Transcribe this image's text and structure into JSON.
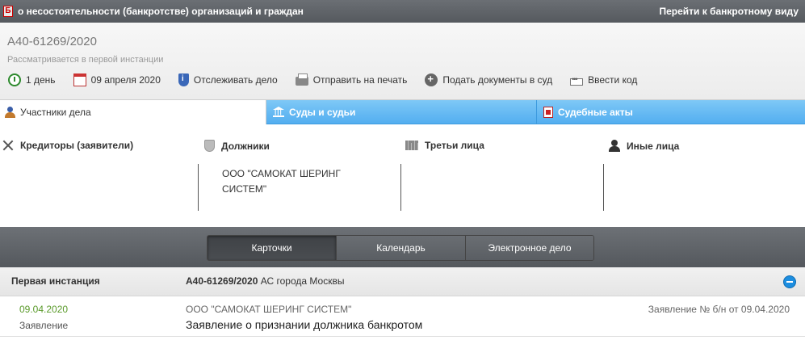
{
  "topbar": {
    "badge": "Б",
    "title": "о несостоятельности (банкротстве) организаций и граждан",
    "switch_link": "Перейти к банкротному виду"
  },
  "case": {
    "number": "А40-61269/2020",
    "status": "Рассматривается в первой инстанции",
    "actions": {
      "duration": "1 день",
      "date": "09 апреля 2020",
      "track": "Отслеживать дело",
      "print": "Отправить на печать",
      "submit": "Подать документы в суд",
      "code": "Ввести код"
    }
  },
  "tabs": {
    "participants": "Участники дела",
    "courts": "Суды и судьи",
    "acts": "Судебные акты"
  },
  "participants": {
    "creditors": "Кредиторы (заявители)",
    "debtors": "Должники",
    "third": "Третьи лица",
    "other": "Иные лица",
    "debtor_name": "ООО \"САМОКАТ ШЕРИНГ СИСТЕМ\""
  },
  "views": {
    "cards": "Карточки",
    "calendar": "Календарь",
    "electronic": "Электронное дело"
  },
  "instance": {
    "title": "Первая инстанция",
    "case_number": "А40-61269/2020",
    "court": "АС города Москвы"
  },
  "document": {
    "date": "09.04.2020",
    "type": "Заявление",
    "organization": "ООО \"САМОКАТ ШЕРИНГ СИСТЕМ\"",
    "title": "Заявление о признании должника банкротом",
    "reference": "Заявление № б/н от 09.04.2020"
  }
}
